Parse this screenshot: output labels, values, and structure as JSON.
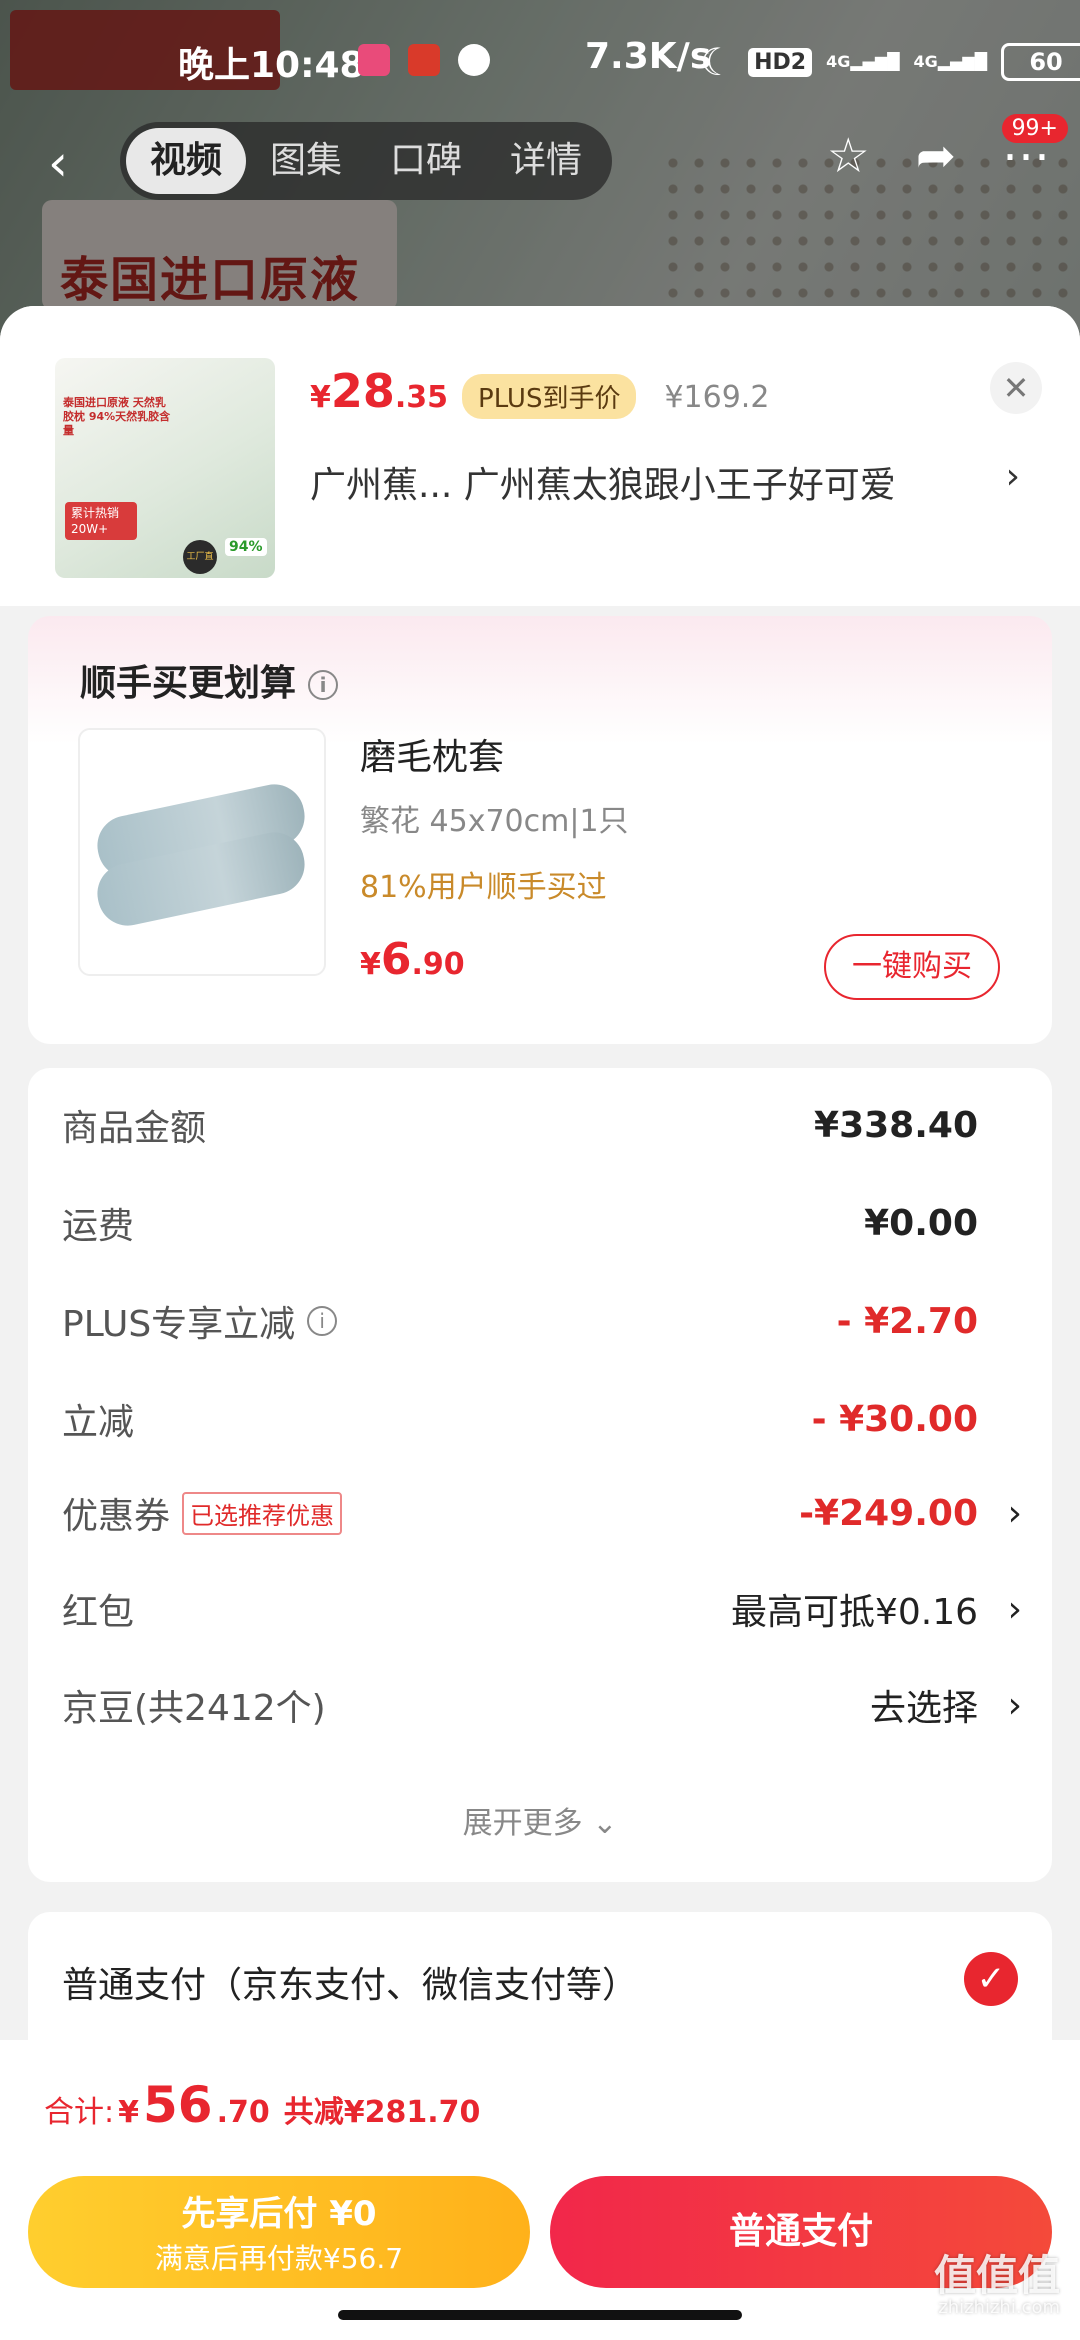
{
  "status_bar": {
    "time": "晚上10:48",
    "net_speed": "7.3K/s",
    "hd": "HD2",
    "signal1": "4G",
    "signal2": "4G",
    "battery": "60"
  },
  "bg": {
    "banner_text": "泰国进口原液"
  },
  "nav": {
    "tabs": [
      "视频",
      "图集",
      "口碑",
      "详情"
    ],
    "badge": "99+"
  },
  "product": {
    "thumb_text1": "泰国进口原液 天然乳胶枕 94%天然乳胶含量",
    "thumb_text2": "累计热销 20W+",
    "thumb_badge": "94%",
    "thumb_factory": "工厂直营",
    "price_symbol": "¥",
    "price_int": "28",
    "price_dec": ".35",
    "plus_tag": "PLUS到手价",
    "orig_price": "¥169.2",
    "address": "广州蕉...  广州蕉太狼跟小王子好可爱"
  },
  "combo": {
    "title": "顺手买更划算",
    "name": "磨毛枕套",
    "spec": "繁花    45x70cm|1只",
    "rate": "81%用户顺手买过",
    "price_symbol": "¥",
    "price_int": "6",
    "price_dec": ".90",
    "buy_label": "一键购买"
  },
  "summary": {
    "rows": [
      {
        "label": "商品金额",
        "value": "¥338.40"
      },
      {
        "label": "运费",
        "value": "¥0.00"
      },
      {
        "label": "PLUS专享立减",
        "value": "- ¥2.70"
      },
      {
        "label": "立减",
        "value": "- ¥30.00"
      },
      {
        "label": "优惠券",
        "tag": "已选推荐优惠",
        "value": "-¥249.00"
      },
      {
        "label": "红包",
        "value": "最高可抵¥0.16"
      },
      {
        "label": "京豆(共2412个)",
        "value": "去选择"
      }
    ],
    "expand": "展开更多"
  },
  "payment": {
    "method": "普通支付（京东支付、微信支付等）"
  },
  "footer": {
    "total_label": "合计:",
    "total_symbol": "¥",
    "total_int": "56",
    "total_dec": ".70",
    "saved": "共减¥281.70",
    "later_line1": "先享后付 ¥0",
    "later_line2": "满意后再付款¥56.7",
    "pay_label": "普通支付"
  },
  "watermark": {
    "brand": "值值值",
    "site": "zhizhizhi.com"
  },
  "colors": {
    "accent_red": "#e8262f",
    "plus_gold": "#fbe2a0",
    "later_yellow": "#ffb11a"
  }
}
